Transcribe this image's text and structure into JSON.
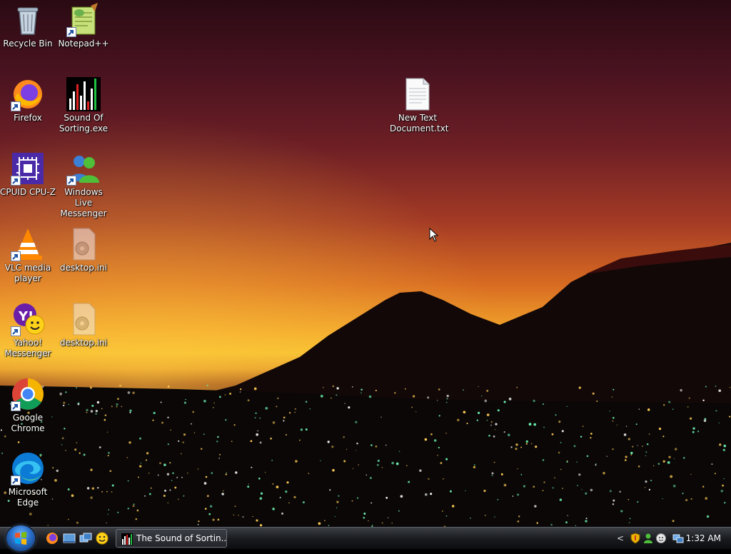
{
  "desktop": {
    "icons": [
      {
        "label": "Recycle Bin",
        "icon": "recycle-bin-icon"
      },
      {
        "label": "Notepad++",
        "icon": "notepad-plus-plus-icon"
      },
      {
        "label": "Firefox",
        "icon": "firefox-icon"
      },
      {
        "label": "Sound Of Sorting.exe",
        "icon": "sound-of-sorting-icon"
      },
      {
        "label": "CPUID CPU-Z",
        "icon": "cpu-z-icon"
      },
      {
        "label": "Windows Live Messenger",
        "icon": "windows-live-messenger-icon"
      },
      {
        "label": "VLC media player",
        "icon": "vlc-icon"
      },
      {
        "label": "desktop.ini",
        "icon": "ini-file-icon"
      },
      {
        "label": "Yahoo! Messenger",
        "icon": "yahoo-messenger-icon"
      },
      {
        "label": "desktop.ini",
        "icon": "ini-file-icon"
      },
      {
        "label": "Google Chrome",
        "icon": "chrome-icon"
      },
      {
        "label": "Microsoft Edge",
        "icon": "edge-icon"
      },
      {
        "label": "New Text Document.txt",
        "icon": "text-document-icon"
      }
    ]
  },
  "taskbar": {
    "task_button": "The Sound of Sortin...",
    "clock": "1:32 AM",
    "tray_arrow": "<"
  },
  "colors": {
    "taskbar": "#1a1c20",
    "start_orb": "#2a6fc9"
  }
}
